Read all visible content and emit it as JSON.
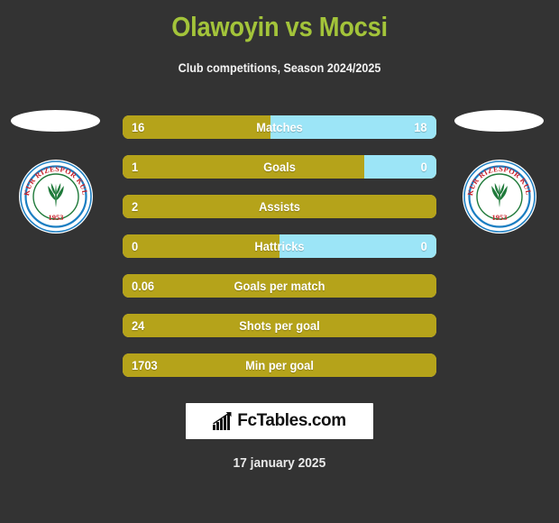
{
  "header": {
    "title": "Olawoyin vs Mocsi",
    "subtitle": "Club competitions, Season 2024/2025"
  },
  "colors": {
    "background": "#333333",
    "title_green": "#a3c43a",
    "home_gold": "#b5a31a",
    "away_blue": "#9ce5f7",
    "text_white": "#ffffff",
    "crest_ring_blue": "#1b7ec2",
    "crest_text_red": "#c8202a",
    "crest_leaf_green": "#1f7a3a"
  },
  "crests": {
    "left": {
      "club_name": "ÇAYKUR RIZESPOR KULÜBÜ",
      "founded": "1953"
    },
    "right": {
      "club_name": "ÇAYKUR RIZESPOR KULÜBÜ",
      "founded": "1953"
    }
  },
  "chart_data": {
    "type": "bar",
    "title": "Olawoyin vs Mocsi",
    "subtitle": "Club competitions, Season 2024/2025",
    "orientation": "horizontal-diverging",
    "series": [
      {
        "name": "Olawoyin",
        "color": "#b5a31a",
        "side": "left"
      },
      {
        "name": "Mocsi",
        "color": "#9ce5f7",
        "side": "right"
      }
    ],
    "categories": [
      "Matches",
      "Goals",
      "Assists",
      "Hattricks",
      "Goals per match",
      "Shots per goal",
      "Min per goal"
    ],
    "rows": [
      {
        "label": "Matches",
        "home": "16",
        "away": "18",
        "home_pct": 47,
        "away_shown": true
      },
      {
        "label": "Goals",
        "home": "1",
        "away": "0",
        "home_pct": 77,
        "away_shown": true
      },
      {
        "label": "Assists",
        "home": "2",
        "away": "",
        "home_pct": 100,
        "away_shown": false
      },
      {
        "label": "Hattricks",
        "home": "0",
        "away": "0",
        "home_pct": 50,
        "away_shown": true
      },
      {
        "label": "Goals per match",
        "home": "0.06",
        "away": "",
        "home_pct": 100,
        "away_shown": false
      },
      {
        "label": "Shots per goal",
        "home": "24",
        "away": "",
        "home_pct": 100,
        "away_shown": false
      },
      {
        "label": "Min per goal",
        "home": "1703",
        "away": "",
        "home_pct": 100,
        "away_shown": false
      }
    ]
  },
  "footer": {
    "brand": "FcTables.com",
    "brand_icon": "bar-chart-growth-icon",
    "date": "17 january 2025"
  }
}
